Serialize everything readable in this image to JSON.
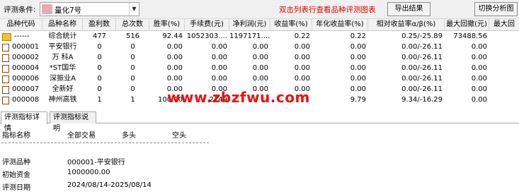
{
  "toolbar": {
    "eval_label": "评测条件:",
    "condition_value": "量化7号",
    "hint": "双击列表行查看品种评测图表",
    "export_label": "导出结果",
    "switch_label": "切换分析图"
  },
  "table": {
    "headers": [
      "品种代码",
      "品种名称",
      "盈利数",
      "总次数",
      "胜率(%)",
      "手续费(元)",
      "净利润(元)",
      "收益率(%)",
      "年化收益率(%)",
      "相对收益率α/β(%)",
      "最大回撤(元)",
      "最大回"
    ],
    "rows": [
      {
        "code": "------",
        "name": "综合统计",
        "wins": "477",
        "total": "516",
        "winrate": "92.44",
        "fee": "1052303....",
        "profit": "1197171....",
        "ret": "0.22",
        "annual": "0.22",
        "relative": "0.25/-25.89",
        "maxdd": "73488.56"
      },
      {
        "code": "000001",
        "name": "平安银行",
        "wins": "0",
        "total": "0",
        "winrate": "0.00",
        "fee": "0.00",
        "profit": "0.00",
        "ret": "0.00",
        "annual": "0.00",
        "relative": "0.00/-26.11",
        "maxdd": "0.00"
      },
      {
        "code": "000002",
        "name": "万 科A",
        "wins": "0",
        "total": "0",
        "winrate": "0.00",
        "fee": "0.00",
        "profit": "0.00",
        "ret": "0.00",
        "annual": "0.00",
        "relative": "0.00/-26.11",
        "maxdd": "0.00"
      },
      {
        "code": "000004",
        "name": "*ST国华",
        "wins": "0",
        "total": "0",
        "winrate": "0.00",
        "fee": "0.00",
        "profit": "0.00",
        "ret": "0.00",
        "annual": "0.00",
        "relative": "0.00/-26.11",
        "maxdd": "0.00"
      },
      {
        "code": "000006",
        "name": "深振业A",
        "wins": "0",
        "total": "0",
        "winrate": "0.00",
        "fee": "0.00",
        "profit": "0.00",
        "ret": "0.00",
        "annual": "0.00",
        "relative": "0.00/-26.11",
        "maxdd": "0.00"
      },
      {
        "code": "000007",
        "name": "全新好",
        "wins": "0",
        "total": "0",
        "winrate": "0.00",
        "fee": "0.00",
        "profit": "0.00",
        "ret": "0.00",
        "annual": "0.00",
        "relative": "0.00/-26.11",
        "maxdd": "0.00"
      },
      {
        "code": "000008",
        "name": "神州高铁",
        "wins": "1",
        "total": "1",
        "winrate": "100.00",
        "fee": "2149",
        "profit": "",
        "ret": "",
        "annual": "9.79",
        "relative": "9.34/-16.29",
        "maxdd": "0.00"
      }
    ]
  },
  "watermark": "www.zbzfwu.com",
  "tabs": [
    "评测指标详情",
    "评测指标说明"
  ],
  "detail": {
    "col_headers": [
      "指标名称",
      "全部交易",
      "多头",
      "空头"
    ],
    "items": [
      {
        "label": "评测品种",
        "value": "000001-平安银行"
      },
      {
        "label": "初始资金",
        "value": "1000000.00"
      },
      {
        "label": "评测日期",
        "value": "2024/08/14-2025/08/14"
      }
    ]
  }
}
